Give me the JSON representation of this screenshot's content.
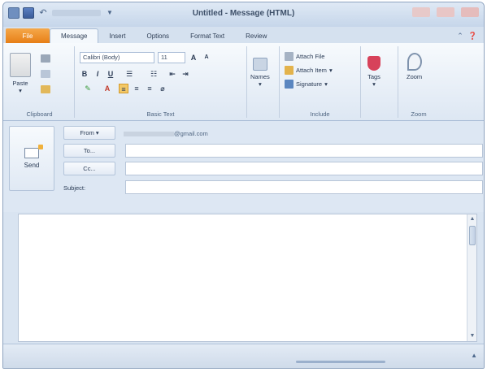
{
  "window": {
    "title": "Untitled - Message (HTML)"
  },
  "tabs": [
    {
      "label": "File"
    },
    {
      "label": "Message"
    },
    {
      "label": "Insert"
    },
    {
      "label": "Options"
    },
    {
      "label": "Format Text"
    },
    {
      "label": "Review"
    }
  ],
  "ribbon": {
    "clipboard": {
      "paste_label": "Paste",
      "group_label": "Clipboard"
    },
    "basic_text": {
      "font_name": "Calibri (Body)",
      "font_size": "11",
      "group_label": "Basic Text"
    },
    "names": {
      "label": "Names"
    },
    "include": {
      "attach_file": "Attach File",
      "attach_item": "Attach Item",
      "signature": "Signature",
      "group_label": "Include"
    },
    "tags": {
      "label": "Tags"
    },
    "zoom": {
      "zoom_label": "Zoom",
      "group_label": "Zoom"
    }
  },
  "message": {
    "send_label": "Send",
    "from_button": "From",
    "from_value": "@gmail.com",
    "to_button": "To...",
    "cc_button": "Cc...",
    "subject_label": "Subject:"
  },
  "colors": {
    "file_tab": "#e77f17",
    "ribbon_bg": "#dde7f3",
    "selected_format": "#f3c866"
  }
}
